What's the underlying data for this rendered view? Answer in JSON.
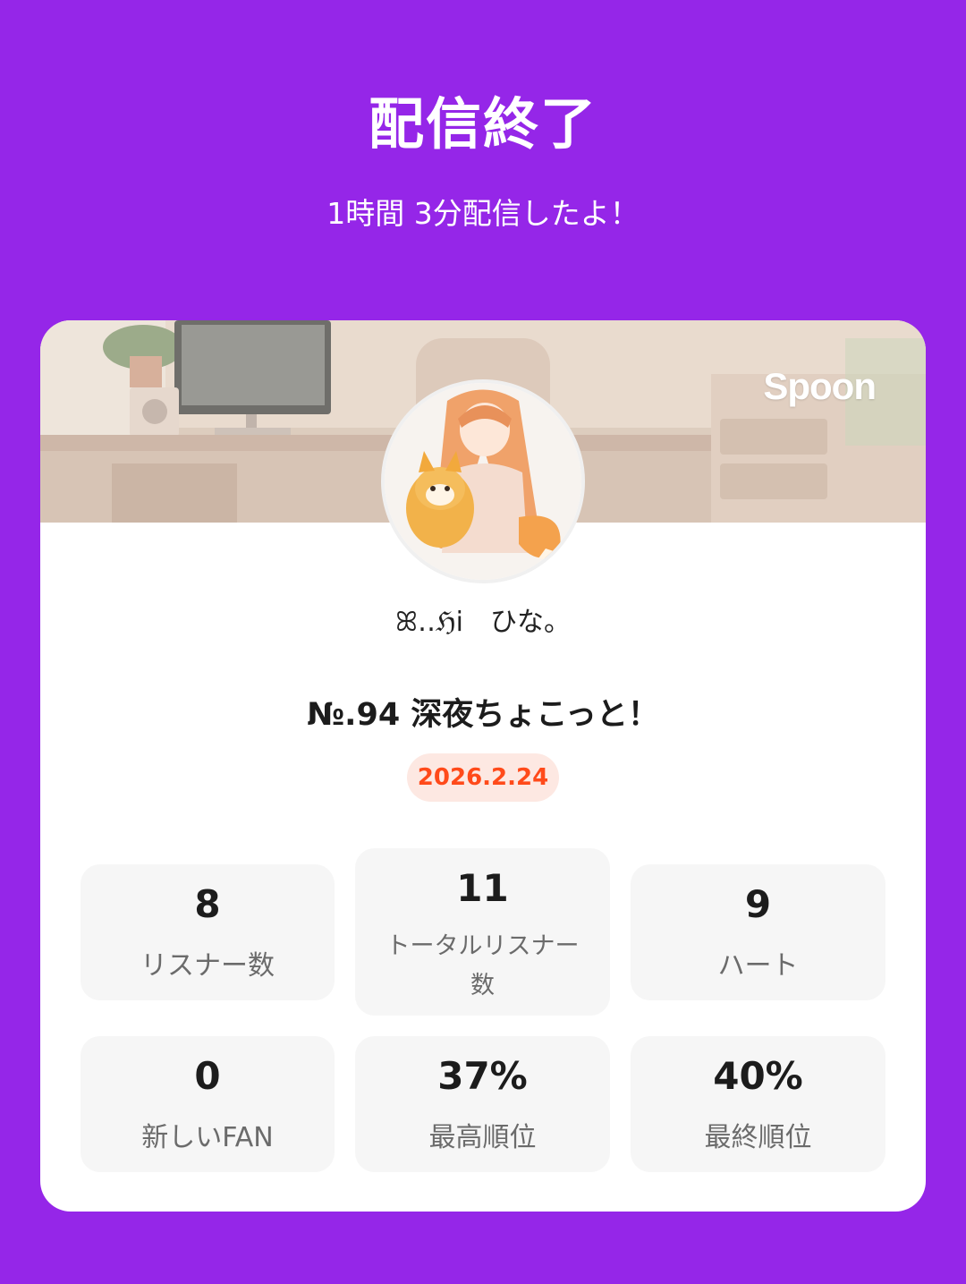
{
  "header": {
    "title": "配信終了",
    "subtitle": "1時間 3分配信したよ！"
  },
  "card": {
    "brand": "Spoon",
    "dj_name": "ꕤ‥ℌi　ひな。",
    "cast_title": "№.94  深夜ちょこっと！",
    "date": "2026.2.24",
    "accent_color": "#ff4a1a",
    "background_color": "#9526e8",
    "stats": [
      {
        "value": "8",
        "label": "リスナー数"
      },
      {
        "value": "11",
        "label": "トータルリスナー数"
      },
      {
        "value": "9",
        "label": "ハート"
      },
      {
        "value": "0",
        "label": "新しいFAN"
      },
      {
        "value": "37%",
        "label": "最高順位"
      },
      {
        "value": "40%",
        "label": "最終順位"
      }
    ]
  }
}
